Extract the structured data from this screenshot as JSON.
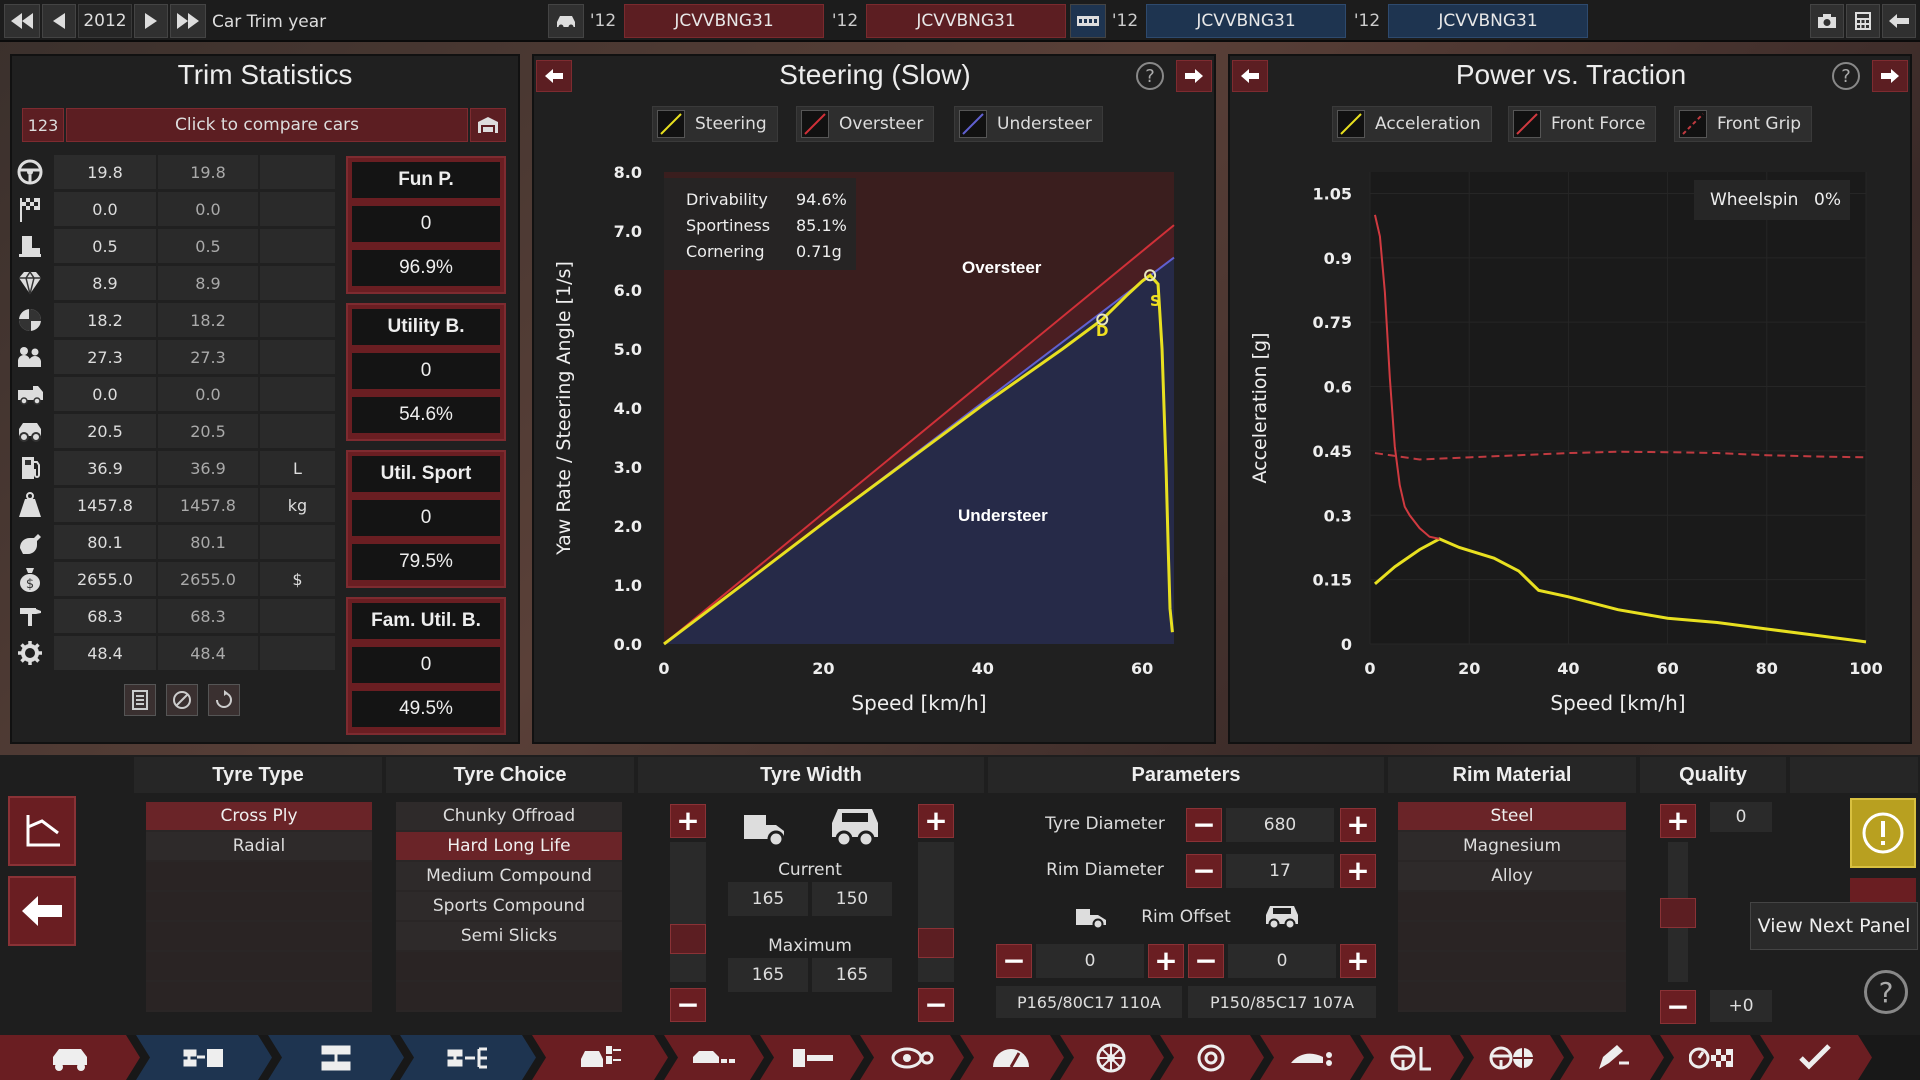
{
  "topbar": {
    "year": "2012",
    "mode_label": "Car Trim year",
    "slots": [
      {
        "year": "'12",
        "name": "JCVVBNG31"
      },
      {
        "year": "'12",
        "name": "JCVVBNG31"
      },
      {
        "year": "'12",
        "name": "JCVVBNG31"
      },
      {
        "year": "'12",
        "name": "JCVVBNG31"
      }
    ]
  },
  "trim": {
    "title": "Trim Statistics",
    "compare_num": "123",
    "compare_label": "Click to compare cars",
    "rows": [
      {
        "icon": "steering-wheel-icon",
        "v1": "19.8",
        "v2": "19.8",
        "unit": ""
      },
      {
        "icon": "race-flag-icon",
        "v1": "0.0",
        "v2": "0.0",
        "unit": ""
      },
      {
        "icon": "seat-icon",
        "v1": "0.5",
        "v2": "0.5",
        "unit": ""
      },
      {
        "icon": "diamond-icon",
        "v1": "8.9",
        "v2": "8.9",
        "unit": ""
      },
      {
        "icon": "safety-shield-icon",
        "v1": "18.2",
        "v2": "18.2",
        "unit": ""
      },
      {
        "icon": "passengers-icon",
        "v1": "27.3",
        "v2": "27.3",
        "unit": ""
      },
      {
        "icon": "cargo-car-icon",
        "v1": "0.0",
        "v2": "0.0",
        "unit": ""
      },
      {
        "icon": "offroad-car-icon",
        "v1": "20.5",
        "v2": "20.5",
        "unit": ""
      },
      {
        "icon": "fuel-icon",
        "v1": "36.9",
        "v2": "36.9",
        "unit": "L"
      },
      {
        "icon": "weight-icon",
        "v1": "1457.8",
        "v2": "1457.8",
        "unit": "kg"
      },
      {
        "icon": "wrench-icon",
        "v1": "80.1",
        "v2": "80.1",
        "unit": ""
      },
      {
        "icon": "money-bag-icon",
        "v1": "2655.0",
        "v2": "2655.0",
        "unit": "$"
      },
      {
        "icon": "hammer-icon",
        "v1": "68.3",
        "v2": "68.3",
        "unit": ""
      },
      {
        "icon": "gear-icon",
        "v1": "48.4",
        "v2": "48.4",
        "unit": ""
      }
    ],
    "ratings": [
      {
        "label": "Fun P.",
        "value": "0",
        "pct": "96.9%"
      },
      {
        "label": "Utility B.",
        "value": "0",
        "pct": "54.6%"
      },
      {
        "label": "Util. Sport",
        "value": "0",
        "pct": "79.5%"
      },
      {
        "label": "Fam. Util. B.",
        "value": "0",
        "pct": "49.5%"
      }
    ]
  },
  "steering": {
    "title": "Steering (Slow)",
    "help": "?",
    "legend": [
      "Steering",
      "Oversteer",
      "Understeer"
    ],
    "stats": [
      {
        "label": "Drivability",
        "value": "94.6%"
      },
      {
        "label": "Sportiness",
        "value": "85.1%"
      },
      {
        "label": "Cornering",
        "value": "0.71g"
      }
    ],
    "region_oversteer": "Oversteer",
    "region_understeer": "Understeer",
    "marker_d": "D",
    "marker_s": "S"
  },
  "power": {
    "title": "Power vs. Traction",
    "help": "?",
    "legend": [
      "Acceleration",
      "Front Force",
      "Front Grip"
    ],
    "wheelspin_label": "Wheelspin",
    "wheelspin_value": "0%"
  },
  "chart_data": [
    {
      "type": "line",
      "title": "Steering (Slow)",
      "xlabel": "Speed [km/h]",
      "ylabel": "Yaw Rate / Steering Angle [1/s]",
      "xlim": [
        0,
        64
      ],
      "ylim": [
        0,
        8
      ],
      "xticks": [
        "0",
        "20",
        "40",
        "60"
      ],
      "yticks": [
        "0.0",
        "1.0",
        "2.0",
        "3.0",
        "4.0",
        "5.0",
        "6.0",
        "7.0",
        "8.0"
      ],
      "series": [
        {
          "name": "Steering",
          "color": "#e8e020",
          "x": [
            0,
            10,
            20,
            30,
            40,
            50,
            55,
            58,
            60,
            61,
            62,
            62.5,
            63,
            63.3,
            63.5,
            63.8
          ],
          "y": [
            0,
            1.02,
            2.05,
            3.05,
            4.05,
            5.0,
            5.5,
            5.9,
            6.15,
            6.25,
            6.1,
            5.0,
            3.0,
            1.5,
            0.6,
            0.2
          ]
        },
        {
          "name": "Oversteer",
          "color": "#d03038",
          "x": [
            0,
            64
          ],
          "y": [
            0,
            7.1
          ]
        },
        {
          "name": "Understeer",
          "color": "#6060d0",
          "x": [
            0,
            64
          ],
          "y": [
            0,
            6.55
          ]
        }
      ]
    },
    {
      "type": "line",
      "title": "Power vs. Traction",
      "xlabel": "Speed [km/h]",
      "ylabel": "Acceleration [g]",
      "xlim": [
        0,
        100
      ],
      "ylim": [
        0,
        1.1
      ],
      "xticks": [
        "0",
        "20",
        "40",
        "60",
        "80",
        "100"
      ],
      "yticks": [
        "0",
        "0.15",
        "0.3",
        "0.45",
        "0.6",
        "0.75",
        "0.9",
        "1.05"
      ],
      "series": [
        {
          "name": "Acceleration",
          "color": "#e8e020",
          "x": [
            1,
            5,
            10,
            14,
            18,
            25,
            30,
            34,
            40,
            50,
            60,
            70,
            80,
            90,
            100
          ],
          "y": [
            0.14,
            0.18,
            0.22,
            0.245,
            0.225,
            0.2,
            0.17,
            0.125,
            0.11,
            0.08,
            0.06,
            0.05,
            0.035,
            0.02,
            0.005
          ]
        },
        {
          "name": "Front Force",
          "color": "#d03a40",
          "x": [
            1,
            2,
            3,
            4,
            5,
            6,
            7,
            8,
            10,
            12,
            14
          ],
          "y": [
            1.0,
            0.95,
            0.82,
            0.62,
            0.46,
            0.37,
            0.32,
            0.3,
            0.27,
            0.25,
            0.245
          ]
        },
        {
          "name": "Front Grip",
          "color": "#c03a40",
          "x": [
            1,
            10,
            20,
            30,
            40,
            50,
            60,
            70,
            80,
            90,
            100
          ],
          "y": [
            0.445,
            0.43,
            0.435,
            0.44,
            0.445,
            0.448,
            0.447,
            0.445,
            0.44,
            0.437,
            0.435
          ]
        }
      ]
    }
  ],
  "bottom": {
    "tyre_type": {
      "title": "Tyre Type",
      "items": [
        "Cross Ply",
        "Radial"
      ],
      "selected": "Cross Ply"
    },
    "tyre_choice": {
      "title": "Tyre Choice",
      "items": [
        "Chunky Offroad",
        "Hard Long Life",
        "Medium Compound",
        "Sports Compound",
        "Semi Slicks"
      ],
      "selected": "Hard Long Life"
    },
    "tyre_width": {
      "title": "Tyre Width",
      "current_label": "Current",
      "maximum_label": "Maximum",
      "current": [
        "165",
        "150"
      ],
      "maximum": [
        "165",
        "165"
      ]
    },
    "parameters": {
      "title": "Parameters",
      "tyre_diameter_label": "Tyre Diameter",
      "tyre_diameter": "680",
      "rim_diameter_label": "Rim Diameter",
      "rim_diameter": "17",
      "rim_offset_label": "Rim Offset",
      "rim_offset_front": "0",
      "rim_offset_rear": "0",
      "code_front": "P165/80C17 110A",
      "code_rear": "P150/85C17 107A"
    },
    "rim_material": {
      "title": "Rim Material",
      "items": [
        "Steel",
        "Magnesium",
        "Alloy"
      ],
      "selected": "Steel"
    },
    "quality": {
      "title": "Quality",
      "value": "0",
      "delta": "+0"
    },
    "tooltip": "View Next Panel"
  }
}
